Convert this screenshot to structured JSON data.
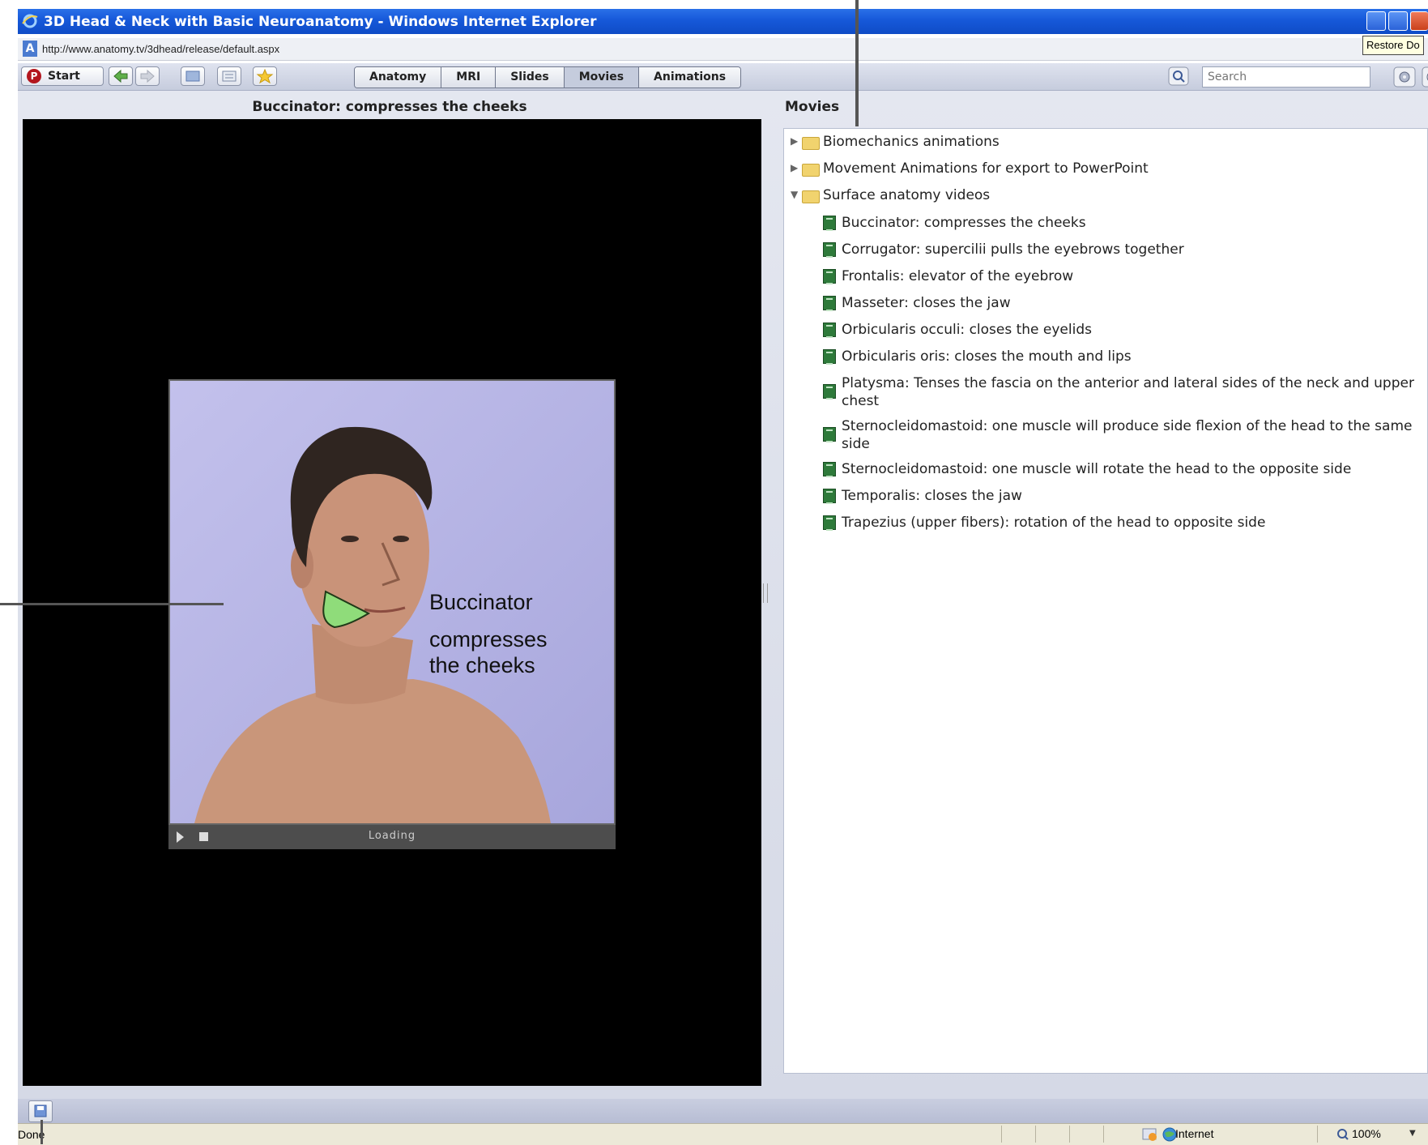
{
  "window": {
    "title": "3D Head & Neck with Basic Neuroanatomy - Windows Internet Explorer",
    "url": "http://www.anatomy.tv/3dhead/release/default.aspx",
    "tooltip": "Restore Do"
  },
  "toolbar": {
    "start_label": "Start",
    "tabs": [
      {
        "label": "Anatomy"
      },
      {
        "label": "MRI"
      },
      {
        "label": "Slides"
      },
      {
        "label": "Movies"
      },
      {
        "label": "Animations"
      }
    ],
    "active_tab": "Movies",
    "search_placeholder": "Search"
  },
  "left_panel": {
    "heading": "Buccinator: compresses the cheeks",
    "video": {
      "caption_line1": "Buccinator",
      "caption_line2": "compresses",
      "caption_line3": "the cheeks",
      "status": "Loading"
    }
  },
  "right_panel": {
    "heading": "Movies",
    "folders": [
      {
        "label": "Biomechanics animations",
        "expanded": false
      },
      {
        "label": "Movement Animations for export to PowerPoint",
        "expanded": false
      },
      {
        "label": "Surface anatomy videos",
        "expanded": true
      }
    ],
    "movies": [
      {
        "label": "Buccinator: compresses the cheeks"
      },
      {
        "label": "Corrugator: supercilii pulls the eyebrows together"
      },
      {
        "label": "Frontalis: elevator of the eyebrow"
      },
      {
        "label": "Masseter: closes the jaw"
      },
      {
        "label": "Orbicularis occuli: closes the eyelids"
      },
      {
        "label": "Orbicularis oris: closes the mouth and lips"
      },
      {
        "label": "Platysma: Tenses the fascia on the anterior and lateral sides of the neck and upper chest"
      },
      {
        "label": "Sternocleidomastoid: one muscle will produce side flexion of the head to the same side"
      },
      {
        "label": "Sternocleidomastoid: one muscle will rotate the head to the opposite side"
      },
      {
        "label": "Temporalis: closes the jaw"
      },
      {
        "label": "Trapezius (upper fibers): rotation of the head to opposite side"
      }
    ]
  },
  "statusbar": {
    "status": "Done",
    "zone": "Internet",
    "zoom": "100%"
  },
  "colors": {
    "titlebar": "#1658d9",
    "video_bg": "#000000",
    "video_backdrop": "#b9b7e6",
    "buccinator_highlight": "#8fdc7a"
  }
}
